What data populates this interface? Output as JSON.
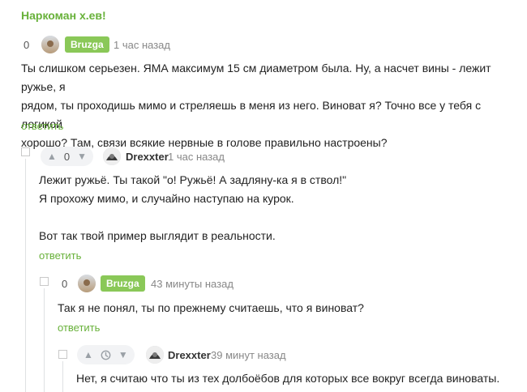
{
  "top_post_title": "Наркоман х.ев!",
  "comments": [
    {
      "rating": "0",
      "author": "Bruzga",
      "time": "1 час назад",
      "text": [
        "Ты слишком серьезен. ЯМА максимум 15 см диаметром была. Ну, а насчет вины - лежит ружье, я",
        "рядом, ты проходишь мимо и стреляешь в меня из него. Виноват я? Точно все у тебя с логикой",
        "хорошо? Там, связи всякие нервные в голове правильно настроены?"
      ],
      "reply": "ответить"
    },
    {
      "rating": "0",
      "author": "Drexxter",
      "time": "1 час назад",
      "text": [
        "Лежит ружьё. Ты такой \"о! Ружьё! А задляну-ка я в ствол!\"",
        "Я прохожу мимо, и случайно наступаю на курок.",
        "",
        "Вот так твой пример выглядит в реальности."
      ],
      "reply": "ответить"
    },
    {
      "rating": "0",
      "author": "Bruzga",
      "time": "43 минуты назад",
      "text": [
        "Так я не понял, ты по прежнему считаешь, что я виноват?"
      ],
      "reply": "ответить"
    },
    {
      "rating_icon": "clock-icon",
      "author": "Drexxter",
      "time": "39 минут назад",
      "text": [
        "Нет, я считаю что ты из тех долбоёбов для которых все вокруг всегда виноваты."
      ]
    }
  ],
  "colors": {
    "accent_green": "#68b13a",
    "badge_green": "#8ac858",
    "muted": "#888888"
  },
  "icons": {
    "upvote": "triangle-up-icon",
    "downvote": "triangle-down-icon",
    "collapse": "collapse-box-icon",
    "avatar": "avatar-icon"
  }
}
